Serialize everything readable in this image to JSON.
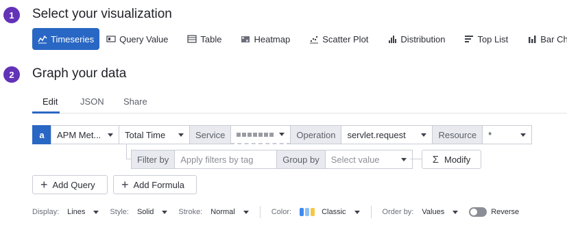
{
  "step1": {
    "number": "1",
    "title": "Select your visualization"
  },
  "visualizations": [
    {
      "label": "Timeseries",
      "icon": "timeseries-icon",
      "active": true
    },
    {
      "label": "Query Value",
      "icon": "query-value-icon"
    },
    {
      "label": "Table",
      "icon": "table-icon"
    },
    {
      "label": "Heatmap",
      "icon": "heatmap-icon"
    },
    {
      "label": "Scatter Plot",
      "icon": "scatter-plot-icon"
    },
    {
      "label": "Distribution",
      "icon": "distribution-icon"
    },
    {
      "label": "Top List",
      "icon": "top-list-icon"
    },
    {
      "label": "Bar Chart",
      "icon": "bar-chart-icon"
    }
  ],
  "step2": {
    "number": "2",
    "title": "Graph your data"
  },
  "tabs": [
    {
      "label": "Edit",
      "active": true
    },
    {
      "label": "JSON"
    },
    {
      "label": "Share"
    }
  ],
  "query": {
    "letter": "a",
    "source": "APM Met...",
    "metric": "Total Time",
    "service_label": "Service",
    "operation_label": "Operation",
    "operation_value": "servlet.request",
    "resource_label": "Resource",
    "resource_value": "*"
  },
  "filter": {
    "filter_label": "Filter by",
    "filter_placeholder": "Apply filters by tag",
    "group_label": "Group by",
    "group_placeholder": "Select value",
    "modify_label": "Modify"
  },
  "actions": {
    "add_query": "Add Query",
    "add_formula": "Add Formula"
  },
  "display": {
    "display_label": "Display:",
    "display_value": "Lines",
    "style_label": "Style:",
    "style_value": "Solid",
    "stroke_label": "Stroke:",
    "stroke_value": "Normal",
    "color_label": "Color:",
    "color_value": "Classic",
    "palette_colors": [
      "#3d8bf0",
      "#8ec0f5",
      "#f5c842"
    ],
    "order_label": "Order by:",
    "order_value": "Values",
    "reverse_label": "Reverse"
  },
  "colors": {
    "accent": "#2967c4",
    "step_badge": "#6232b7"
  }
}
